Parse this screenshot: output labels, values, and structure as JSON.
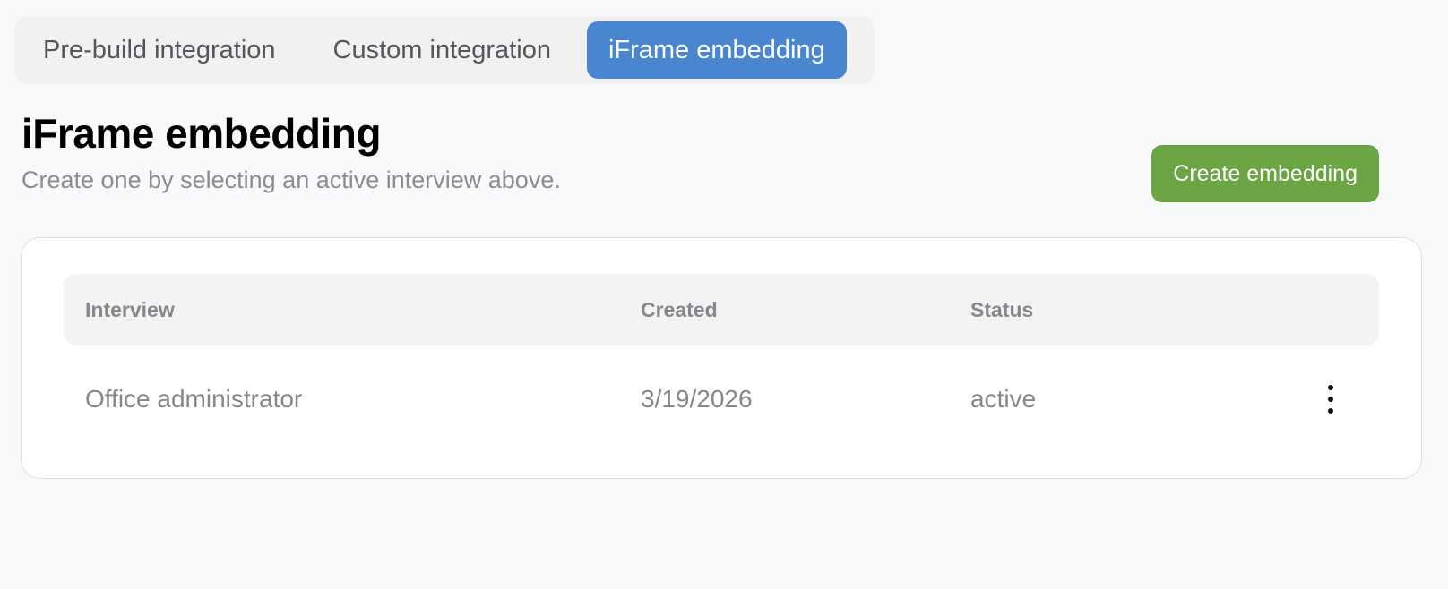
{
  "tabs": [
    {
      "label": "Pre-build integration",
      "active": false
    },
    {
      "label": "Custom integration",
      "active": false
    },
    {
      "label": "iFrame embedding",
      "active": true
    }
  ],
  "page": {
    "title": "iFrame embedding",
    "subtitle": "Create one by selecting an active interview above.",
    "create_button_label": "Create embedding"
  },
  "table": {
    "columns": [
      "Interview",
      "Created",
      "Status"
    ],
    "rows": [
      {
        "interview": "Office administrator",
        "created": "3/19/2026",
        "status": "active",
        "actions_icon": "more-vertical-icon"
      }
    ]
  },
  "colors": {
    "active_tab": "#4a86d0",
    "create_button": "#6aa443",
    "muted_text": "#86878c",
    "background": "#f8f9fb"
  }
}
